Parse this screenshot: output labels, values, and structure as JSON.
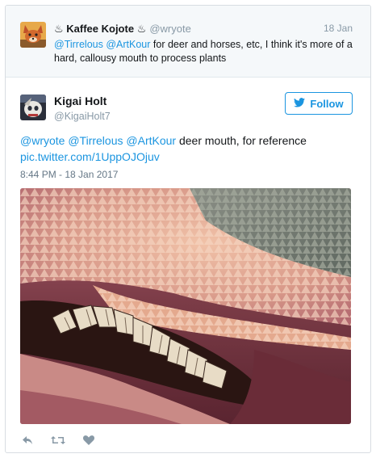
{
  "parent_tweet": {
    "display_name": "♨ Kaffee Kojote ♨",
    "handle": "@wryote",
    "date": "18 Jan",
    "mentions": [
      "@Tirrelous",
      "@ArtKour"
    ],
    "body": "for deer and horses, etc, I think it's more of a hard, callousy mouth to process plants",
    "avatar_icon": "fox-avatar-icon"
  },
  "tweet": {
    "display_name": "Kigai Holt",
    "handle": "@KigaiHolt7",
    "follow_label": "Follow",
    "mentions": [
      "@wryote",
      "@Tirrelous",
      "@ArtKour"
    ],
    "body": "deer mouth, for reference",
    "link": "pic.twitter.com/1UppOJOjuv",
    "timestamp": "8:44 PM - 18 Jan 2017",
    "avatar_icon": "skull-avatar-icon"
  },
  "actions": [
    {
      "name": "reply",
      "icon": "reply-icon"
    },
    {
      "name": "retweet",
      "icon": "retweet-icon"
    },
    {
      "name": "like",
      "icon": "heart-icon"
    }
  ],
  "colors": {
    "link": "#1b95e0",
    "muted": "#8899a6",
    "parent_bg": "#f5f8fa"
  }
}
